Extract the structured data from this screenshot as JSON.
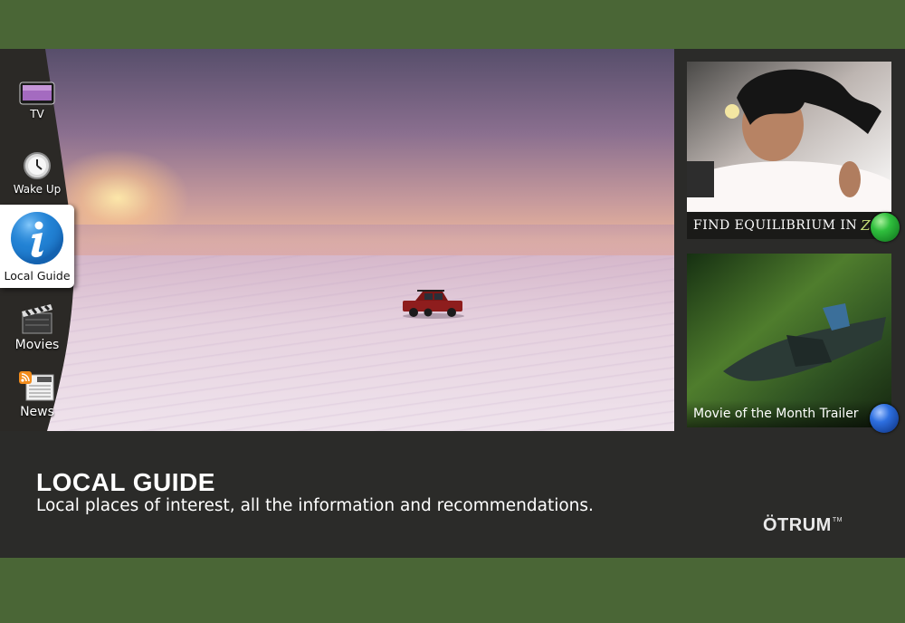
{
  "menu": {
    "items": [
      {
        "label": "TV",
        "icon": "tv-icon"
      },
      {
        "label": "Wake Up",
        "icon": "alarm-clock-icon"
      },
      {
        "label": "Local Guide",
        "icon": "info-icon",
        "active": true
      },
      {
        "label": "Movies",
        "icon": "clapperboard-icon"
      },
      {
        "label": "News",
        "icon": "rss-newspaper-icon"
      }
    ]
  },
  "promos": [
    {
      "caption": "FIND EQUILIBRIUM IN",
      "caption_accent": "Zen",
      "button": "green-button",
      "color": "#2fbf3d"
    },
    {
      "caption": "Movie of the Month Trailer",
      "button": "blue-button",
      "color": "#2d6fe0"
    }
  ],
  "info": {
    "title": "LOCAL GUIDE",
    "description": "Local places of interest, all the information and recommendations."
  },
  "brand": {
    "logo": "ÖTRUM",
    "trademark": "TM"
  },
  "colors": {
    "outer_background": "#4a6636",
    "panel_background": "#2b2b29"
  }
}
